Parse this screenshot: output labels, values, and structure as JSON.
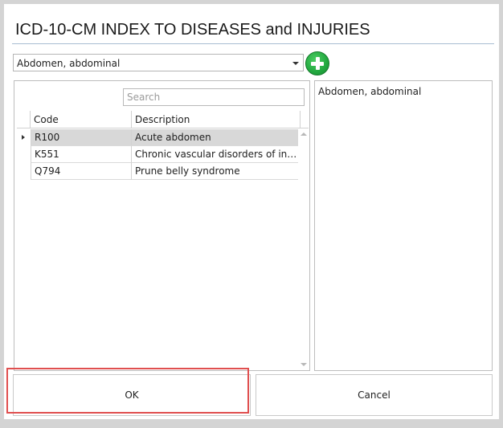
{
  "dialog": {
    "title": "ICD-10-CM INDEX TO DISEASES and INJURIES"
  },
  "term_select": {
    "value": "Abdomen, abdominal",
    "add_icon": "plus-circle-icon"
  },
  "search": {
    "placeholder": "Search",
    "value": ""
  },
  "grid": {
    "columns": [
      "Code",
      "Description"
    ],
    "rows": [
      {
        "code": "R100",
        "description": "Acute abdomen",
        "selected": true
      },
      {
        "code": "K551",
        "description": "Chronic vascular disorders of intestine",
        "selected": false
      },
      {
        "code": "Q794",
        "description": "Prune belly syndrome",
        "selected": false
      }
    ]
  },
  "detail_panel": {
    "text": "Abdomen, abdominal"
  },
  "buttons": {
    "ok": "OK",
    "cancel": "Cancel"
  },
  "colors": {
    "accent_rule": "#a7bdd1",
    "add_green": "#22a83f",
    "selection": "#d8d8d8",
    "highlight_box": "#e04f4f"
  }
}
